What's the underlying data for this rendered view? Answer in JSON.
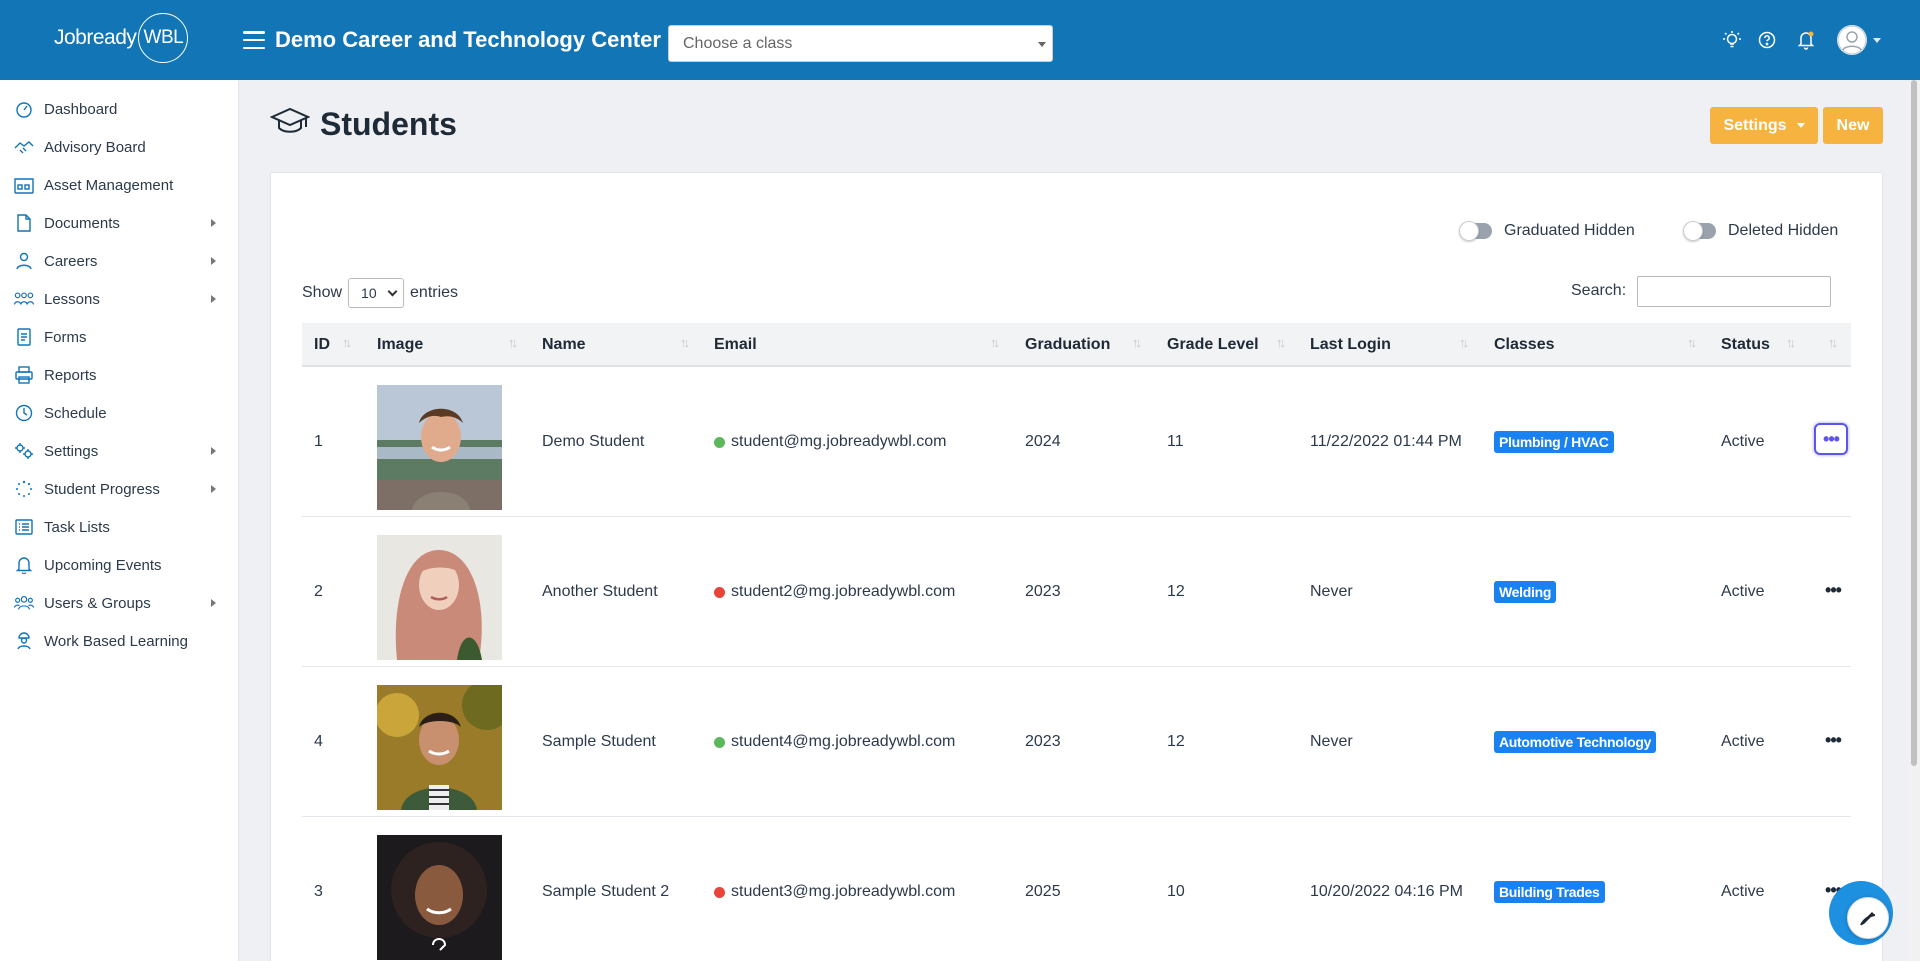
{
  "header": {
    "logo_text": "Jobready",
    "logo_circle_text": "WBL",
    "org_title": "Demo Career and Technology Center",
    "class_select_placeholder": "Choose a class",
    "icons": [
      "lightbulb-icon",
      "help-icon",
      "bell-icon",
      "user-avatar"
    ]
  },
  "sidebar": {
    "items": [
      {
        "label": "Dashboard",
        "icon": "dashboard-icon",
        "has_submenu": false
      },
      {
        "label": "Advisory Board",
        "icon": "handshake-icon",
        "has_submenu": false
      },
      {
        "label": "Asset Management",
        "icon": "warehouse-icon",
        "has_submenu": false
      },
      {
        "label": "Documents",
        "icon": "document-icon",
        "has_submenu": true
      },
      {
        "label": "Careers",
        "icon": "person-icon",
        "has_submenu": true
      },
      {
        "label": "Lessons",
        "icon": "classroom-icon",
        "has_submenu": true
      },
      {
        "label": "Forms",
        "icon": "form-icon",
        "has_submenu": false
      },
      {
        "label": "Reports",
        "icon": "printer-icon",
        "has_submenu": false
      },
      {
        "label": "Schedule",
        "icon": "clock-icon",
        "has_submenu": false
      },
      {
        "label": "Settings",
        "icon": "gears-icon",
        "has_submenu": true
      },
      {
        "label": "Student Progress",
        "icon": "spinner-icon",
        "has_submenu": true
      },
      {
        "label": "Task Lists",
        "icon": "list-icon",
        "has_submenu": false
      },
      {
        "label": "Upcoming Events",
        "icon": "bell-icon",
        "has_submenu": false
      },
      {
        "label": "Users & Groups",
        "icon": "users-icon",
        "has_submenu": true
      },
      {
        "label": "Work Based Learning",
        "icon": "worker-icon",
        "has_submenu": false
      }
    ]
  },
  "page": {
    "title": "Students",
    "settings_button": "Settings",
    "new_button": "New",
    "toggle_graduated": "Graduated Hidden",
    "toggle_deleted": "Deleted Hidden",
    "show_label": "Show",
    "entries_value": "10",
    "entries_label": "entries",
    "search_label": "Search:"
  },
  "table": {
    "columns": [
      "ID",
      "Image",
      "Name",
      "Email",
      "Graduation",
      "Grade Level",
      "Last Login",
      "Classes",
      "Status"
    ],
    "rows": [
      {
        "id": "1",
        "name": "Demo Student",
        "email": "student@mg.jobreadywbl.com",
        "email_status_color": "#5cb85c",
        "graduation": "2024",
        "grade": "11",
        "last_login": "11/22/2022 01:44 PM",
        "class": "Plumbing / HVAC",
        "status": "Active",
        "photo": "young man with short brown hair smiling, lake background"
      },
      {
        "id": "2",
        "name": "Another Student",
        "email": "student2@mg.jobreadywbl.com",
        "email_status_color": "#e8443a",
        "graduation": "2023",
        "grade": "12",
        "last_login": "Never",
        "class": "Welding",
        "status": "Active",
        "photo": "young woman with long pink hair"
      },
      {
        "id": "4",
        "name": "Sample Student",
        "email": "student4@mg.jobreadywbl.com",
        "email_status_color": "#5cb85c",
        "graduation": "2023",
        "grade": "12",
        "last_login": "Never",
        "class": "Automotive Technology",
        "status": "Active",
        "photo": "smiling man in green jacket, autumn background"
      },
      {
        "id": "3",
        "name": "Sample Student 2",
        "email": "student3@mg.jobreadywbl.com",
        "email_status_color": "#e8443a",
        "graduation": "2025",
        "grade": "10",
        "last_login": "10/20/2022 04:16 PM",
        "class": "Building Trades",
        "status": "Active",
        "photo": "woman with curly dark hair smiling"
      }
    ]
  },
  "colors": {
    "topbar": "#1275b5",
    "accent_orange": "#f7b340",
    "badge_blue": "#1a82f0"
  }
}
